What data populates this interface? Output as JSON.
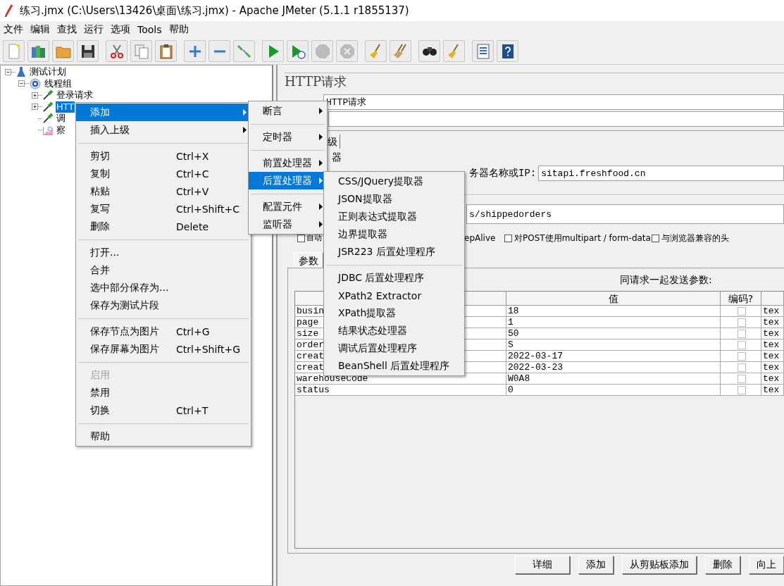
{
  "window": {
    "title": "练习.jmx (C:\\Users\\13426\\桌面\\练习.jmx) - Apache JMeter (5.1.1 r1855137)"
  },
  "menu_bar": [
    "文件",
    "编辑",
    "查找",
    "运行",
    "选项",
    "Tools",
    "帮助"
  ],
  "tree": [
    {
      "label": "测试计划",
      "kind": "plan",
      "expanded": true,
      "selected": false,
      "children": [
        {
          "label": "线程组",
          "kind": "thread_group",
          "expanded": true,
          "selected": false,
          "children": [
            {
              "label": "登录请求",
              "kind": "sampler",
              "expanded": false,
              "selected": false
            },
            {
              "label": "HTT",
              "kind": "sampler",
              "expanded": false,
              "selected": true
            },
            {
              "label": "调",
              "kind": "sampler",
              "selected": false
            },
            {
              "label": "察",
              "kind": "listener",
              "selected": false
            }
          ]
        }
      ]
    }
  ],
  "context_menu": [
    {
      "kind": "item",
      "label": "添加",
      "submenu": true,
      "selected": true,
      "disabled": false
    },
    {
      "kind": "item",
      "label": "插入上级",
      "submenu": true,
      "selected": false,
      "disabled": false
    },
    {
      "kind": "separator"
    },
    {
      "kind": "item",
      "label": "剪切",
      "shortcut": "Ctrl+X",
      "selected": false,
      "disabled": false
    },
    {
      "kind": "item",
      "label": "复制",
      "shortcut": "Ctrl+C",
      "selected": false,
      "disabled": false
    },
    {
      "kind": "item",
      "label": "粘贴",
      "shortcut": "Ctrl+V",
      "selected": false,
      "disabled": false
    },
    {
      "kind": "item",
      "label": "复写",
      "shortcut": "Ctrl+Shift+C",
      "selected": false,
      "disabled": false
    },
    {
      "kind": "item",
      "label": "删除",
      "shortcut": "Delete",
      "selected": false,
      "disabled": false
    },
    {
      "kind": "separator"
    },
    {
      "kind": "item",
      "label": "打开...",
      "selected": false,
      "disabled": false
    },
    {
      "kind": "item",
      "label": "合并",
      "selected": false,
      "disabled": false
    },
    {
      "kind": "item",
      "label": "选中部分保存为...",
      "selected": false,
      "disabled": false
    },
    {
      "kind": "item",
      "label": "保存为测试片段",
      "selected": false,
      "disabled": false
    },
    {
      "kind": "separator"
    },
    {
      "kind": "item",
      "label": "保存节点为图片",
      "shortcut": "Ctrl+G",
      "selected": false,
      "disabled": false
    },
    {
      "kind": "item",
      "label": "保存屏幕为图片",
      "shortcut": "Ctrl+Shift+G",
      "selected": false,
      "disabled": false
    },
    {
      "kind": "separator"
    },
    {
      "kind": "item",
      "label": "启用",
      "selected": false,
      "disabled": true
    },
    {
      "kind": "item",
      "label": "禁用",
      "selected": false,
      "disabled": false
    },
    {
      "kind": "item",
      "label": "切换",
      "shortcut": "Ctrl+T",
      "selected": false,
      "disabled": false
    },
    {
      "kind": "separator"
    },
    {
      "kind": "item",
      "label": "帮助",
      "selected": false,
      "disabled": false
    }
  ],
  "add_submenu": [
    {
      "kind": "item",
      "label": "断言",
      "submenu": true,
      "selected": false,
      "disabled": false
    },
    {
      "kind": "separator"
    },
    {
      "kind": "item",
      "label": "定时器",
      "submenu": true,
      "selected": false,
      "disabled": false
    },
    {
      "kind": "separator"
    },
    {
      "kind": "item",
      "label": "前置处理器",
      "submenu": true,
      "selected": false,
      "disabled": false
    },
    {
      "kind": "item",
      "label": "后置处理器",
      "submenu": true,
      "selected": true,
      "disabled": false
    },
    {
      "kind": "separator"
    },
    {
      "kind": "item",
      "label": "配置元件",
      "submenu": true,
      "selected": false,
      "disabled": false
    },
    {
      "kind": "item",
      "label": "监听器",
      "submenu": true,
      "selected": false,
      "disabled": false
    }
  ],
  "post_processor_submenu": [
    {
      "kind": "item",
      "label": "CSS/JQuery提取器",
      "selected": false,
      "disabled": false
    },
    {
      "kind": "item",
      "label": "JSON提取器",
      "selected": false,
      "disabled": false
    },
    {
      "kind": "item",
      "label": "正则表达式提取器",
      "selected": false,
      "disabled": false
    },
    {
      "kind": "item",
      "label": "边界提取器",
      "selected": false,
      "disabled": false
    },
    {
      "kind": "item",
      "label": "JSR223 后置处理程序",
      "selected": false,
      "disabled": false
    },
    {
      "kind": "separator"
    },
    {
      "kind": "item",
      "label": "JDBC 后置处理程序",
      "selected": false,
      "disabled": false
    },
    {
      "kind": "item",
      "label": "XPath2 Extractor",
      "selected": false,
      "disabled": false
    },
    {
      "kind": "item",
      "label": "XPath提取器",
      "selected": false,
      "disabled": false
    },
    {
      "kind": "item",
      "label": "结果状态处理器",
      "selected": false,
      "disabled": false
    },
    {
      "kind": "item",
      "label": "调试后置处理程序",
      "selected": false,
      "disabled": false
    },
    {
      "kind": "item",
      "label": "BeanShell 后置处理程序",
      "selected": false,
      "disabled": false
    }
  ],
  "editor": {
    "title": "HTTP请求",
    "name_value": "HTTP请求",
    "tabs": [
      {
        "label": "级",
        "selected": false
      }
    ],
    "section_label": "器",
    "server_label": "务器名称或IP:",
    "server_value": "sitapi.freshfood.cn",
    "path_value": "s/shippedorders",
    "options": [
      {
        "kind": "checkbox",
        "label": "自动",
        "checked": false
      },
      {
        "kind": "text",
        "label": "epAlive"
      },
      {
        "kind": "checkbox",
        "label": "对POST使用multipart / form-data",
        "checked": false
      },
      {
        "kind": "checkbox",
        "label": "与浏览器兼容的头",
        "checked": false
      }
    ],
    "param_tabs": [
      {
        "label": "参数",
        "selected": true
      }
    ],
    "table_caption": "同请求一起发送参数:",
    "columns": [
      "值",
      "编码?"
    ],
    "rows": [
      {
        "name": "busin",
        "value": "18",
        "encode": false,
        "column_4": "tex"
      },
      {
        "name": "page",
        "value": "1",
        "encode": false,
        "column_4": "tex"
      },
      {
        "name": "size",
        "value": "50",
        "encode": false,
        "column_4": "tex"
      },
      {
        "name": "order",
        "value": "S",
        "encode": false,
        "column_4": "tex"
      },
      {
        "name": "creat",
        "value": "2022-03-17",
        "encode": false,
        "column_4": "tex"
      },
      {
        "name": "creat",
        "value": "2022-03-23",
        "encode": false,
        "column_4": "tex"
      },
      {
        "name": "warehouseCode",
        "value": "W0A8",
        "encode": false,
        "column_4": "tex"
      },
      {
        "name": "status",
        "value": "0",
        "encode": false,
        "column_4": "tex"
      }
    ],
    "buttons": [
      "详细",
      "添加",
      "从剪贴板添加",
      "删除",
      "向上"
    ]
  }
}
